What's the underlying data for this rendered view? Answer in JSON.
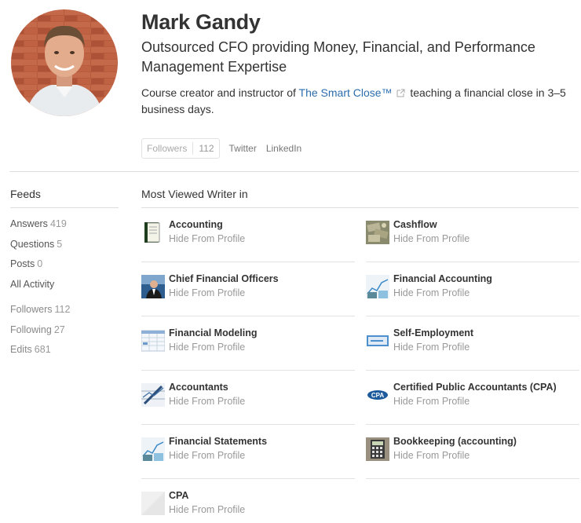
{
  "profile": {
    "name": "Mark Gandy",
    "headline": "Outsourced CFO providing Money, Financial, and Performance Management Expertise",
    "bio_before": "Course creator and instructor of ",
    "bio_link": "The Smart Close™",
    "bio_after": " teaching a financial close in 3–5 business days."
  },
  "social": {
    "followers_label": "Followers",
    "followers_count": "112",
    "twitter": "Twitter",
    "linkedin": "LinkedIn"
  },
  "sidebar": {
    "title": "Feeds",
    "group1": [
      {
        "label": "Answers",
        "count": "419"
      },
      {
        "label": "Questions",
        "count": "5"
      },
      {
        "label": "Posts",
        "count": "0"
      },
      {
        "label": "All Activity",
        "count": ""
      }
    ],
    "group2": [
      {
        "label": "Followers",
        "count": "112"
      },
      {
        "label": "Following",
        "count": "27"
      },
      {
        "label": "Edits",
        "count": "681"
      }
    ]
  },
  "main": {
    "title": "Most Viewed Writer in",
    "hide_label": "Hide From Profile",
    "topics": [
      {
        "name": "Accounting",
        "icon": "ledger-book-icon"
      },
      {
        "name": "Cashflow",
        "icon": "money-pile-icon"
      },
      {
        "name": "Chief Financial Officers",
        "icon": "businessman-icon"
      },
      {
        "name": "Financial Accounting",
        "icon": "chart-sketch-icon"
      },
      {
        "name": "Financial Modeling",
        "icon": "spreadsheet-icon"
      },
      {
        "name": "Self-Employment",
        "icon": "business-card-icon"
      },
      {
        "name": "Accountants",
        "icon": "pen-chart-icon"
      },
      {
        "name": "Certified Public Accountants (CPA)",
        "icon": "cpa-logo-icon"
      },
      {
        "name": "Financial Statements",
        "icon": "chart-sketch-icon"
      },
      {
        "name": "Bookkeeping (accounting)",
        "icon": "calculator-icon"
      },
      {
        "name": "CPA",
        "icon": "placeholder-icon"
      }
    ]
  }
}
